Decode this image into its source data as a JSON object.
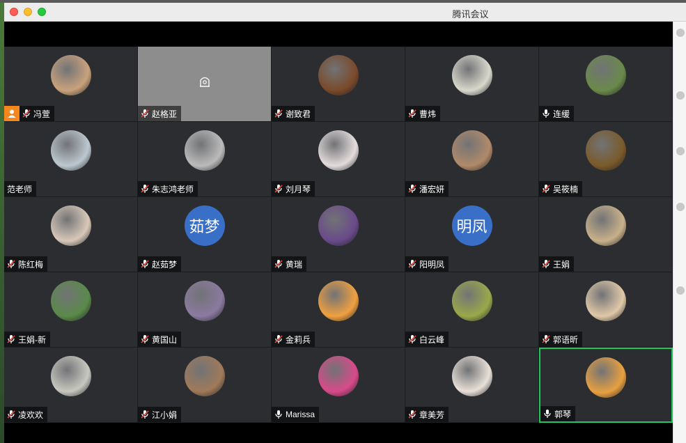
{
  "window": {
    "title": "腾讯会议"
  },
  "colors": {
    "active_border": "#1ec85a",
    "host_badge": "#f5871f",
    "tile_bg": "#2b2d31",
    "text_avatar_bg": "#3a6fc8"
  },
  "participants": [
    {
      "name": "冯萱",
      "mic": "muted",
      "host": true,
      "avatar": "pig-photo",
      "color": "#c9a27c"
    },
    {
      "name": "赵格亚",
      "mic": "muted",
      "video_off_camera": true
    },
    {
      "name": "谢致君",
      "mic": "muted",
      "avatar": "bear-photo",
      "color": "#7a4a2a"
    },
    {
      "name": "曹炜",
      "mic": "muted",
      "avatar": "cup-photo",
      "color": "#d8d8cc"
    },
    {
      "name": "连缓",
      "mic": "on",
      "avatar": "flowers-photo",
      "color": "#6a8a4a"
    },
    {
      "name": "范老师",
      "mic": "none",
      "avatar": "birds-photo",
      "color": "#bcc8d0"
    },
    {
      "name": "朱志鸿老师",
      "mic": "muted",
      "avatar": "swan-photo",
      "color": "#bbbbbb"
    },
    {
      "name": "刘月琴",
      "mic": "muted",
      "avatar": "painting-photo",
      "color": "#e4dcdc"
    },
    {
      "name": "潘宏妍",
      "mic": "muted",
      "avatar": "family-photo",
      "color": "#b08a6a"
    },
    {
      "name": "吴筱楠",
      "mic": "muted",
      "avatar": "autumn-photo",
      "color": "#7a5a2a"
    },
    {
      "name": "陈红梅",
      "mic": "muted",
      "avatar": "woman-photo",
      "color": "#d8c8b8"
    },
    {
      "name": "赵茹梦",
      "mic": "muted",
      "avatar_text": "茹梦"
    },
    {
      "name": "黄瑞",
      "mic": "muted",
      "avatar": "anime-photo",
      "color": "#6a4a8a"
    },
    {
      "name": "阳明凤",
      "mic": "muted",
      "avatar_text": "明凤"
    },
    {
      "name": "王娟",
      "mic": "muted",
      "avatar": "girl-photo",
      "color": "#c8b08a"
    },
    {
      "name": "王娟-新",
      "mic": "muted",
      "avatar": "woman-park-photo",
      "color": "#5a8a4a"
    },
    {
      "name": "黄国山",
      "mic": "muted",
      "avatar": "lake-photo",
      "color": "#8a7aa0"
    },
    {
      "name": "金莉兵",
      "mic": "muted",
      "avatar": "cartoon-photo",
      "color": "#f0a040"
    },
    {
      "name": "白云峰",
      "mic": "muted",
      "avatar": "field-photo",
      "color": "#9aa84a"
    },
    {
      "name": "郭语昕",
      "mic": "muted",
      "avatar": "cat-photo",
      "color": "#e0c8a8"
    },
    {
      "name": "凌欢欢",
      "mic": "muted",
      "avatar": "car-photo",
      "color": "#c8c8c0"
    },
    {
      "name": "江小娟",
      "mic": "muted",
      "avatar": "building-photo",
      "color": "#a07a5a"
    },
    {
      "name": "Marissa",
      "mic": "on",
      "avatar": "blossom-photo",
      "color": "#d84a8a"
    },
    {
      "name": "章美芳",
      "mic": "muted",
      "avatar": "children-photo",
      "color": "#e8e0d8"
    },
    {
      "name": "郭琴",
      "mic": "on",
      "active": true,
      "avatar": "sunset-photo",
      "color": "#e8a040"
    }
  ]
}
